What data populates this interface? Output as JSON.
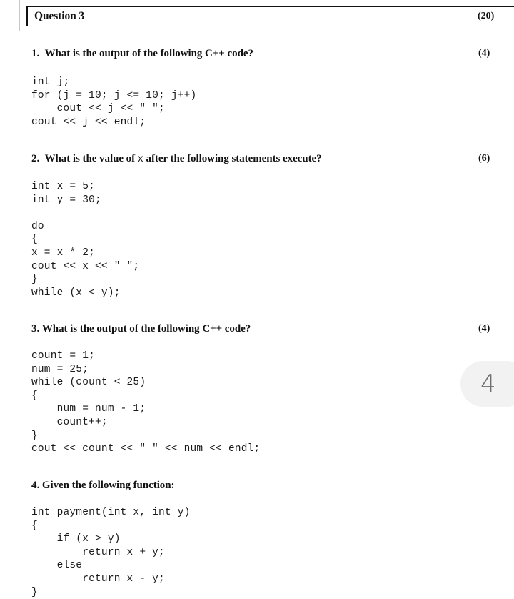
{
  "document": {
    "background_color": "#ffffff",
    "text_color": "#111111"
  },
  "header": {
    "title": "Question 3",
    "marks": "(20)"
  },
  "questions": [
    {
      "number": "1.",
      "prompt": "What is the output of the following C++ code?",
      "marks": "(4)",
      "code": "int j;\nfor (j = 10; j <= 10; j++)\n    cout << j << \" \";\ncout << j << endl;"
    },
    {
      "number": "2.",
      "prompt_before": "What is the value of",
      "prompt_var": "x",
      "prompt_after": "after the following statements execute?",
      "marks": "(6)",
      "code": "int x = 5;\nint y = 30;\n\ndo\n{\nx = x * 2;\ncout << x << \" \";\n}\nwhile (x < y);"
    },
    {
      "number": "3.",
      "prompt": "What is the output of the following C++ code?",
      "marks": "(4)",
      "code": "count = 1;\nnum = 25;\nwhile (count < 25)\n{\n    num = num - 1;\n    count++;\n}\ncout << count << \" \" << num << endl;"
    },
    {
      "number": "4.",
      "prompt": "Given the following function:",
      "marks": "",
      "code": "int payment(int x, int y)\n{\n    if (x > y)\n        return x + y;\n    else\n        return x - y;\n}"
    }
  ],
  "page_badge": {
    "number": "4",
    "background_color": "#f2f2f2",
    "text_color": "#6e6e6e"
  }
}
